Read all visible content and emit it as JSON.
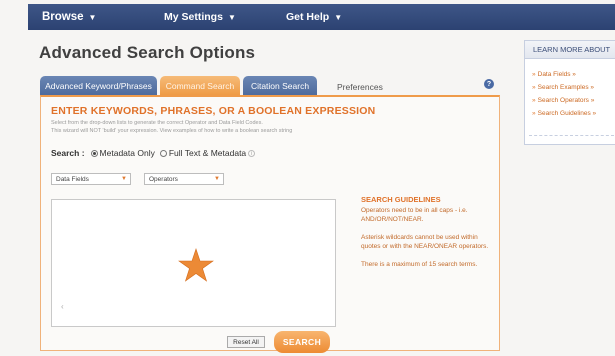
{
  "nav": {
    "browse": "Browse",
    "settings": "My Settings",
    "help": "Get Help"
  },
  "page_title": "Advanced Search Options",
  "tabs": {
    "advanced": "Advanced Keyword/Phrases",
    "command": "Command Search",
    "citation": "Citation Search",
    "preferences": "Preferences"
  },
  "panel": {
    "heading": "ENTER KEYWORDS, PHRASES, OR A BOOLEAN EXPRESSION",
    "desc_line1": "Select from the drop-down lists to generate the correct Operator and Data Field Codes.",
    "desc_line2": "This wizard will NOT 'build' your expression. View examples of how to write a boolean search string",
    "search_label": "Search :",
    "option_metadata": "Metadata Only",
    "option_fulltext": "Full Text & Metadata",
    "dd_fields": "Data Fields",
    "dd_operators": "Operators",
    "reset_label": "Reset All",
    "search_label_btn": "SEARCH"
  },
  "guidelines": {
    "title": "SEARCH GUIDELINES",
    "p1": "Operators need to be in all caps - i.e. AND/OR/NOT/NEAR.",
    "p2": "Asterisk wildcards cannot be used within quotes or with the NEAR/ONEAR operators.",
    "p3": "There is a maximum of 15 search terms."
  },
  "learn_more": {
    "title": "LEARN MORE ABOUT",
    "items": [
      "Data Fields »",
      "Search Examples »",
      "Search Operators »",
      "Search Guidelines »"
    ]
  },
  "colors": {
    "nav_bg": "#2c4272",
    "accent_orange": "#ee9a44",
    "tab_blue": "#4d6a9b"
  }
}
